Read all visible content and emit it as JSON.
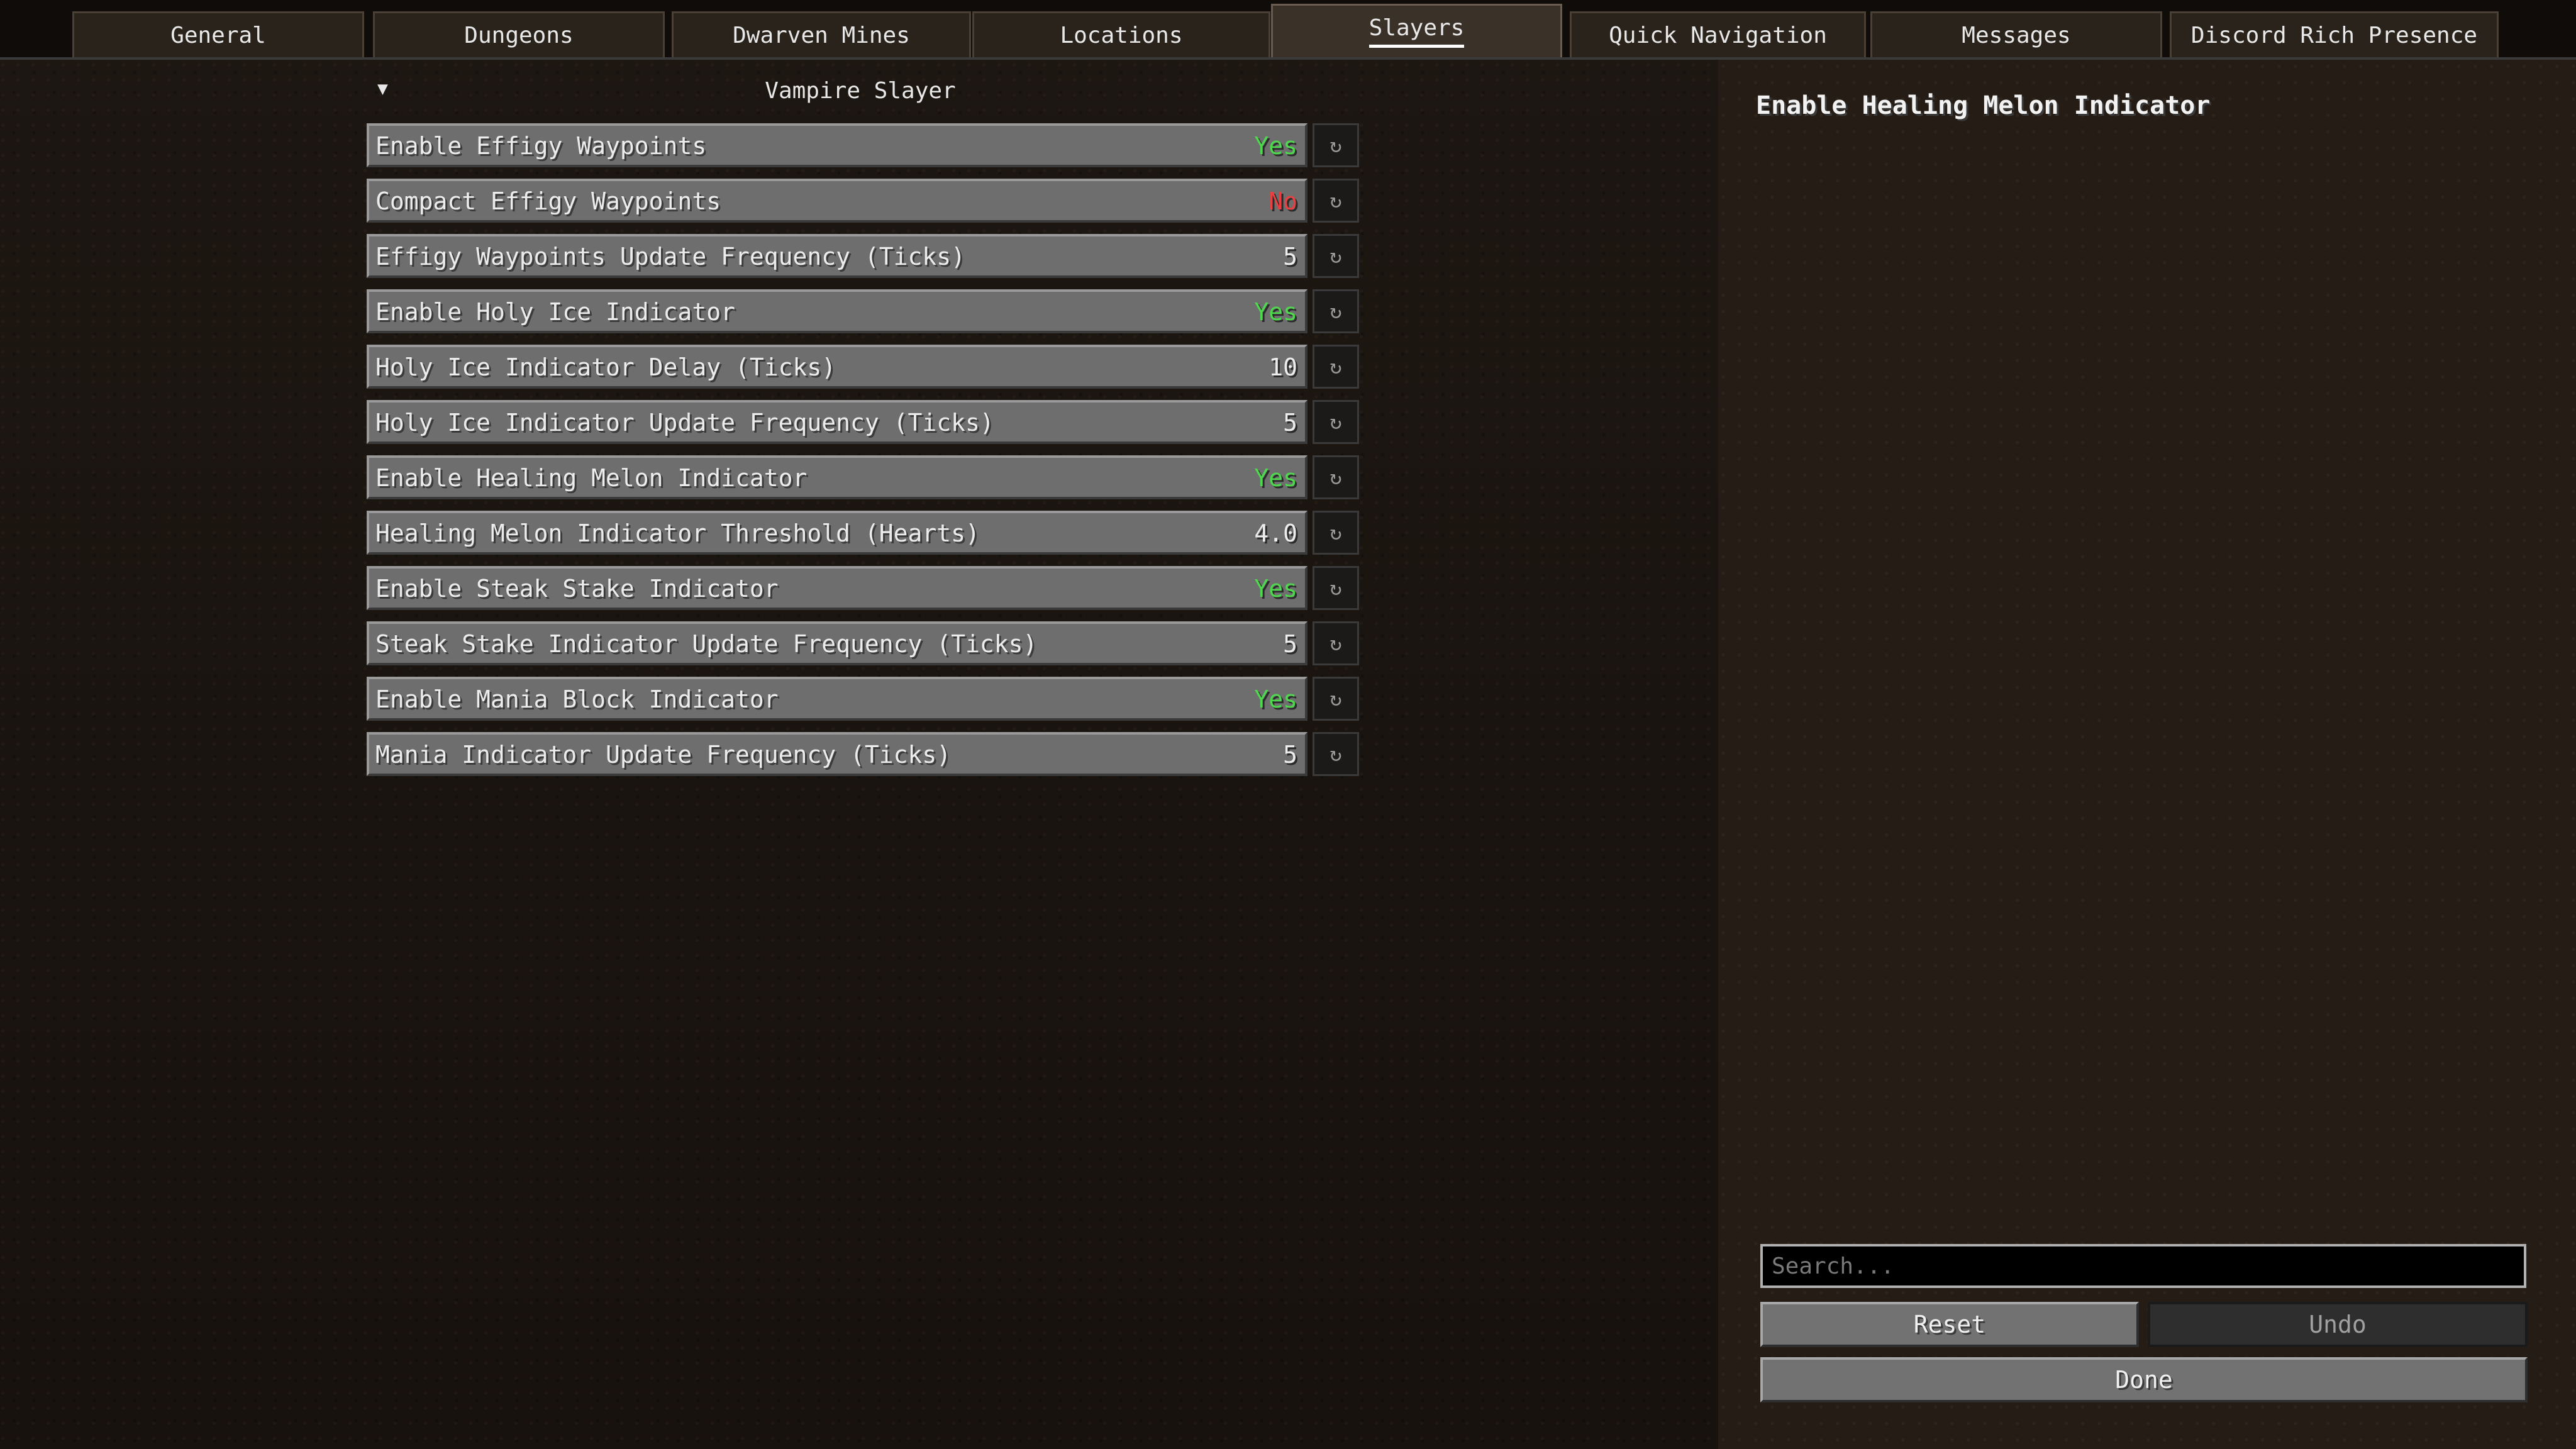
{
  "tabs": [
    {
      "label": "General",
      "active": false
    },
    {
      "label": "Dungeons",
      "active": false
    },
    {
      "label": "Dwarven Mines",
      "active": false
    },
    {
      "label": "Locations",
      "active": false
    },
    {
      "label": "Slayers",
      "active": true
    },
    {
      "label": "Quick Navigation",
      "active": false
    },
    {
      "label": "Messages",
      "active": false
    },
    {
      "label": "Discord Rich Presence",
      "active": false
    }
  ],
  "group": {
    "title": "Vampire Slayer",
    "collapse_icon": "triangle-down-icon"
  },
  "options": [
    {
      "label": "Enable Effigy Waypoints",
      "value": "Yes",
      "kind": "yes"
    },
    {
      "label": "Compact Effigy Waypoints",
      "value": "No",
      "kind": "no"
    },
    {
      "label": "Effigy Waypoints Update Frequency (Ticks)",
      "value": "5",
      "kind": "num"
    },
    {
      "label": "Enable Holy Ice Indicator",
      "value": "Yes",
      "kind": "yes"
    },
    {
      "label": "Holy Ice Indicator Delay (Ticks)",
      "value": "10",
      "kind": "num"
    },
    {
      "label": "Holy Ice Indicator Update Frequency (Ticks)",
      "value": "5",
      "kind": "num"
    },
    {
      "label": "Enable Healing Melon Indicator",
      "value": "Yes",
      "kind": "yes"
    },
    {
      "label": "Healing Melon Indicator Threshold (Hearts)",
      "value": "4.0",
      "kind": "num"
    },
    {
      "label": "Enable Steak Stake Indicator",
      "value": "Yes",
      "kind": "yes"
    },
    {
      "label": "Steak Stake Indicator Update Frequency (Ticks)",
      "value": "5",
      "kind": "num"
    },
    {
      "label": "Enable Mania Block Indicator",
      "value": "Yes",
      "kind": "yes"
    },
    {
      "label": "Mania Indicator Update Frequency (Ticks)",
      "value": "5",
      "kind": "num"
    }
  ],
  "reset_icon": "↻",
  "side_panel": {
    "title": "Enable Healing Melon Indicator",
    "search_placeholder": "Search...",
    "reset_label": "Reset",
    "undo_label": "Undo",
    "done_label": "Done"
  },
  "colors": {
    "yes": "#4ed84e",
    "no": "#e84040"
  }
}
